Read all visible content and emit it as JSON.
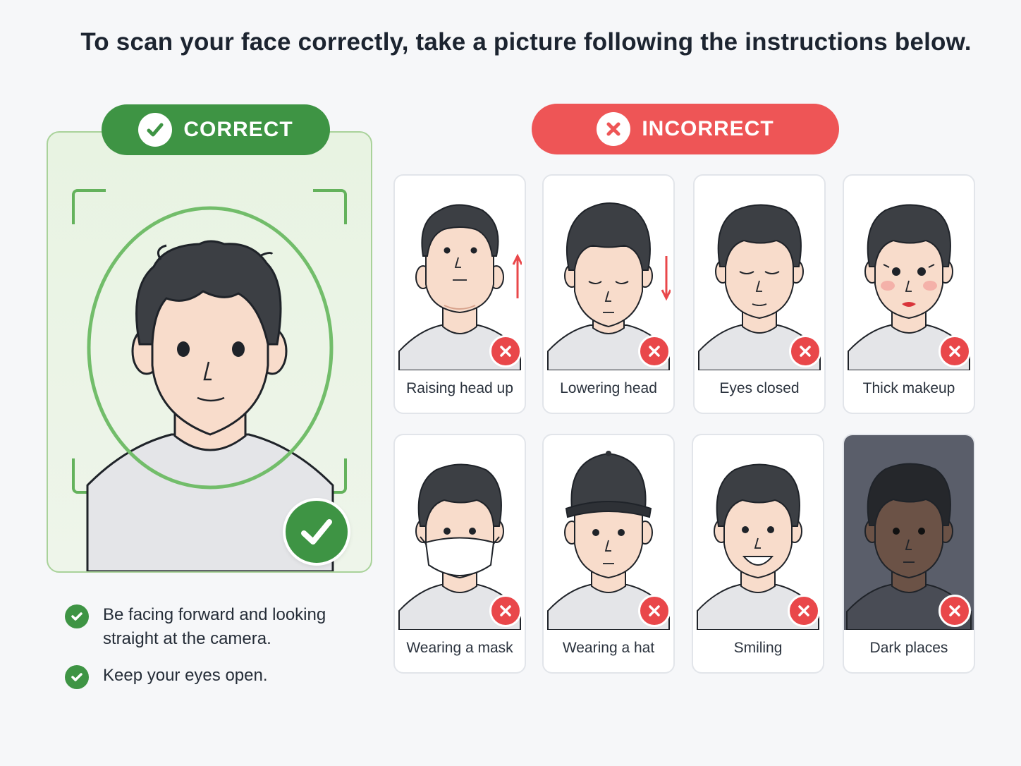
{
  "title": "To scan your face correctly, take a picture following the instructions below.",
  "correct": {
    "label": "CORRECT",
    "instructions": [
      "Be facing forward and looking straight at the camera.",
      "Keep your eyes open."
    ]
  },
  "incorrect": {
    "label": "INCORRECT",
    "cards": [
      {
        "label": "Raising head up"
      },
      {
        "label": "Lowering head"
      },
      {
        "label": "Eyes closed"
      },
      {
        "label": "Thick makeup"
      },
      {
        "label": "Wearing a mask"
      },
      {
        "label": "Wearing a hat"
      },
      {
        "label": "Smiling"
      },
      {
        "label": "Dark places"
      }
    ]
  },
  "colors": {
    "correct_green": "#3e9444",
    "incorrect_red": "#ee5556",
    "panel_bg": "#e8f3e2",
    "dark_bg": "#5a5e6a"
  },
  "icons": [
    "check-icon",
    "x-icon",
    "up-arrow-icon",
    "down-arrow-icon"
  ]
}
